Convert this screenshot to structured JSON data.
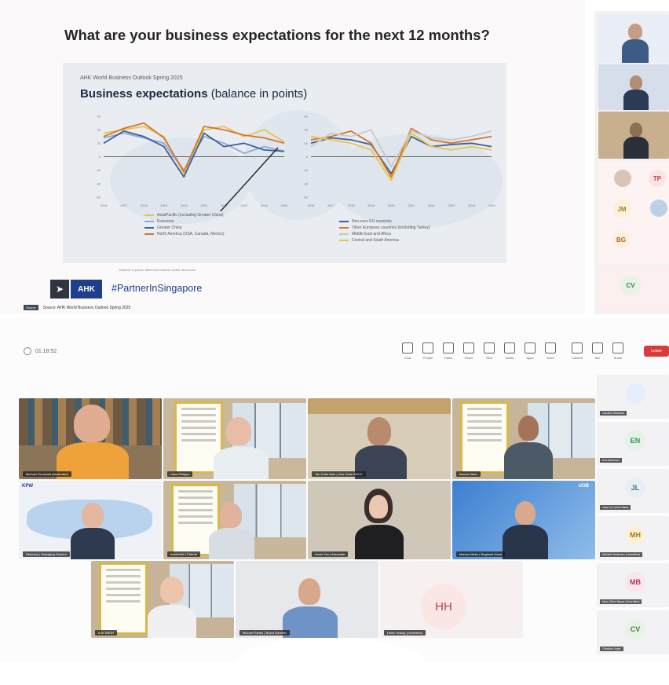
{
  "slide": {
    "heading": "What are your business expectations for the next 12 months?",
    "chart_source_top": "AHK World Business Outlook Spring 2025",
    "chart_title_bold": "Business expectations",
    "chart_title_rest": " (balance in points)",
    "footnote": "Balance in points: difference between better and worse",
    "logo_text": "AHK",
    "hashtag": "#PartnerInSingapore",
    "source_tag": "Source",
    "source_line": "Source: AHK World Business Outlook Spring 2025"
  },
  "chart_data": [
    {
      "type": "line",
      "title": "Business expectations (balance in points)",
      "x": [
        "2016",
        "2017",
        "2018",
        "2019",
        "2020",
        "2021",
        "2022",
        "2023",
        "2024",
        "2025"
      ],
      "yticks": [
        60,
        40,
        20,
        0,
        -20,
        -40,
        -60
      ],
      "ylim": [
        -60,
        60
      ],
      "legend_placement": "bottom",
      "series": [
        {
          "name": "Asia/Pacific (excluding Greater China)",
          "color": "#e8c34a",
          "values": [
            35,
            40,
            45,
            30,
            -25,
            40,
            45,
            30,
            40,
            22
          ]
        },
        {
          "name": "Eurozone",
          "color": "#8fa9d6",
          "values": [
            28,
            35,
            28,
            20,
            -20,
            30,
            20,
            5,
            15,
            8
          ]
        },
        {
          "name": "Greater China",
          "color": "#3f5f9b",
          "values": [
            20,
            38,
            30,
            15,
            -30,
            35,
            15,
            20,
            10,
            8
          ]
        },
        {
          "name": "North America (USA, Canada, Mexico)",
          "color": "#d4762e",
          "values": [
            30,
            42,
            50,
            28,
            -22,
            45,
            40,
            32,
            28,
            20
          ]
        }
      ]
    },
    {
      "type": "line",
      "title": "",
      "x": [
        "2016",
        "2017",
        "2018",
        "2019",
        "2020",
        "2021",
        "2022",
        "2023",
        "2024",
        "2025"
      ],
      "yticks": [
        60,
        40,
        20,
        0,
        -20,
        -40,
        -60
      ],
      "ylim": [
        -60,
        60
      ],
      "legend_placement": "bottom",
      "series": [
        {
          "name": "Non-euro EU countries",
          "color": "#3f5f9b",
          "values": [
            20,
            28,
            25,
            18,
            -25,
            30,
            15,
            18,
            20,
            15
          ]
        },
        {
          "name": "Other European countries (excluding Turkey)",
          "color": "#d4762e",
          "values": [
            25,
            30,
            38,
            20,
            -30,
            42,
            25,
            20,
            25,
            30
          ]
        },
        {
          "name": "Middle East and Africa",
          "color": "#c9c9c9",
          "values": [
            15,
            35,
            30,
            40,
            -15,
            38,
            28,
            25,
            30,
            38
          ]
        },
        {
          "name": "Central and South America",
          "color": "#e8c34a",
          "values": [
            30,
            25,
            20,
            10,
            -35,
            35,
            15,
            10,
            15,
            10
          ]
        }
      ]
    }
  ],
  "side_top": {
    "participants": [
      {
        "initials": "TP",
        "color": "#fbe3e3",
        "text": "#c0404a"
      },
      {
        "initials": "JM",
        "color": "#fbf1dc",
        "text": "#b07a22"
      },
      {
        "initials": "BG",
        "color": "#fcefdf",
        "text": "#b0652a"
      },
      {
        "initials": "CV",
        "color": "#e8f2e6",
        "text": "#4a7a44"
      }
    ]
  },
  "meeting": {
    "meeting_id": "01:18:52",
    "toolbar": [
      "Chat",
      "People",
      "Raise",
      "React",
      "View",
      "Notes",
      "Apps",
      "More",
      "Camera",
      "Mic",
      "Share"
    ],
    "leave_label": "Leave",
    "tiles": [
      {
        "name": "Michael Grunwald (Moderator)"
      },
      {
        "name": "Hans Philipps"
      },
      {
        "name": "Tan Chee Wee | Vice Chair SGCC"
      },
      {
        "name": "Bianca Stark"
      },
      {
        "name": "Rebekah | Managing Director"
      },
      {
        "name": "Annabelle | Partner"
      },
      {
        "name": "Annie Yeo | Associate"
      },
      {
        "name": "Markus Meier | Regional Head"
      },
      {
        "name": "Kurt Weber"
      },
      {
        "name": "Michael Riedel | Board Member"
      },
      {
        "name": "Helen Huang (Unverified)",
        "initials": "HH"
      }
    ],
    "side_list": [
      {
        "name": "Caroline Sheridan",
        "initials": "",
        "color": "#e6eefb",
        "text": "#3a5fa0"
      },
      {
        "name": "Eva Neumann",
        "initials": "EN",
        "color": "#e4f3e9",
        "text": "#3f8a5a"
      },
      {
        "name": "Jana Lee (Unverified)",
        "initials": "JL",
        "color": "#e7eef4",
        "text": "#4a6a8a"
      },
      {
        "name": "Michelle Hartmann (Unverified)",
        "initials": "MH",
        "color": "#fbf1d9",
        "text": "#a77a1f"
      },
      {
        "name": "Marc-Oliver Bauer (Unverified)",
        "initials": "MB",
        "color": "#fae5ec",
        "text": "#b03a64"
      },
      {
        "name": "Christine Vogel",
        "initials": "CV",
        "color": "#e8f2e6",
        "text": "#4a7a44"
      }
    ]
  }
}
